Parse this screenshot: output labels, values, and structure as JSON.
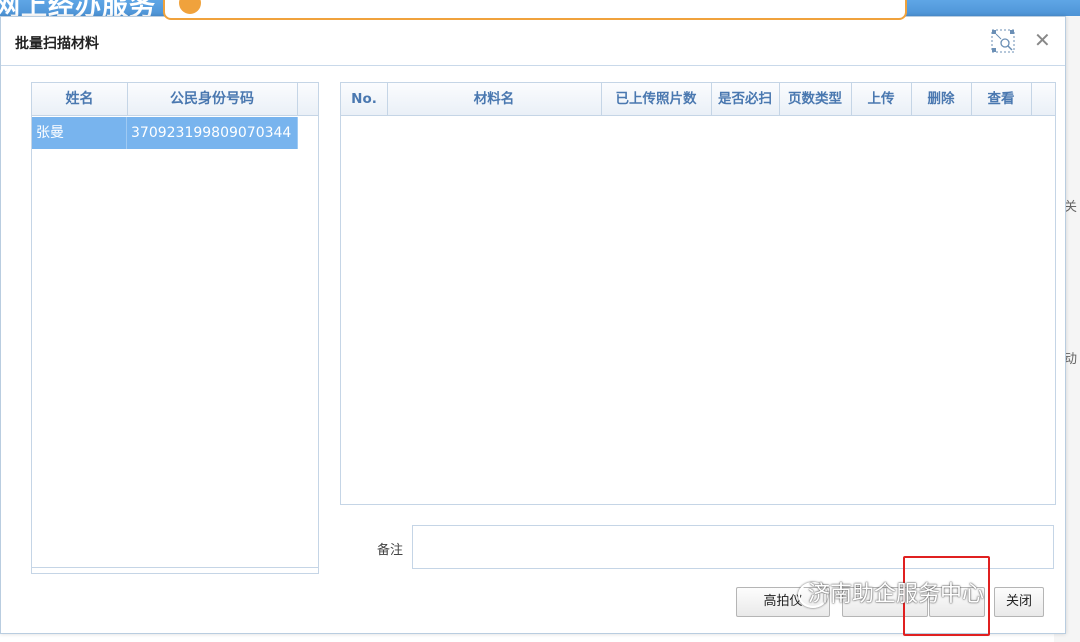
{
  "background": {
    "page_title": "网上经办服务",
    "side_text_1": "关",
    "side_text_2": "动"
  },
  "dialog": {
    "title": "批量扫描材料"
  },
  "person_list": {
    "headers": [
      "姓名",
      "公民身份号码"
    ],
    "rows": [
      {
        "name": "张曼",
        "id_number": "370923199809070344"
      }
    ]
  },
  "material_table": {
    "headers": [
      "No.",
      "材料名",
      "已上传照片数",
      "是否必扫",
      "页数类型",
      "上传",
      "删除",
      "查看"
    ]
  },
  "remark": {
    "label": "备注",
    "value": ""
  },
  "buttons": {
    "scanner": "高拍仪",
    "save": "",
    "close": "关闭"
  },
  "watermark": "济南助企服务中心"
}
